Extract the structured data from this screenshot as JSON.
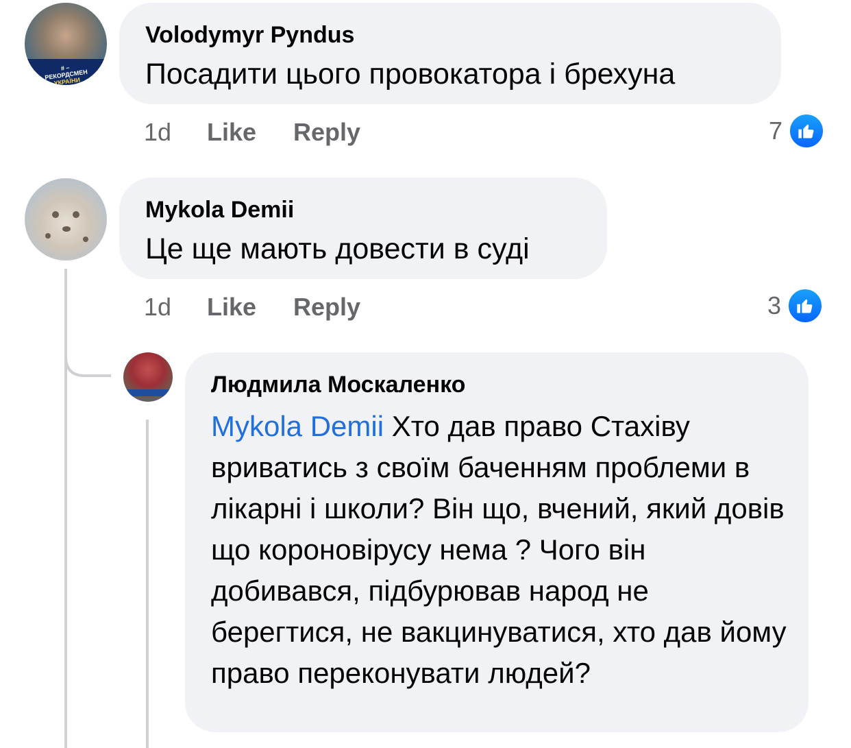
{
  "comments": [
    {
      "author": "Volodymyr Pyndus",
      "text": "Посадити цього провокатора і брехуна",
      "time": "1d",
      "like_label": "Like",
      "reply_label": "Reply",
      "reaction_count": "7",
      "avatar_badge_line1": "# – РЕКОРДСМЕН",
      "avatar_badge_line2": "УКРАЇНИ"
    },
    {
      "author": "Mykola Demii",
      "text": "Це ще мають довести в суді",
      "time": "1d",
      "like_label": "Like",
      "reply_label": "Reply",
      "reaction_count": "3"
    }
  ],
  "reply": {
    "author": "Людмила Москаленко",
    "mention": "Mykola Demii",
    "text": " Хто дав право Стахіву вриватись з своїм баченням проблеми в лікарні і школи? Він що, вчений, який довів  що короновірусу нема ? Чого він добивався, підбурював народ не берегтися, не вакцинуватися, хто дав йому право переконувати людей?"
  },
  "colors": {
    "bubble": "#f0f2f5",
    "mention": "#216fdb",
    "meta_text": "#65676b",
    "like_badge": "#0866ff"
  },
  "icons": {
    "reaction": "thumbs-up-icon"
  }
}
